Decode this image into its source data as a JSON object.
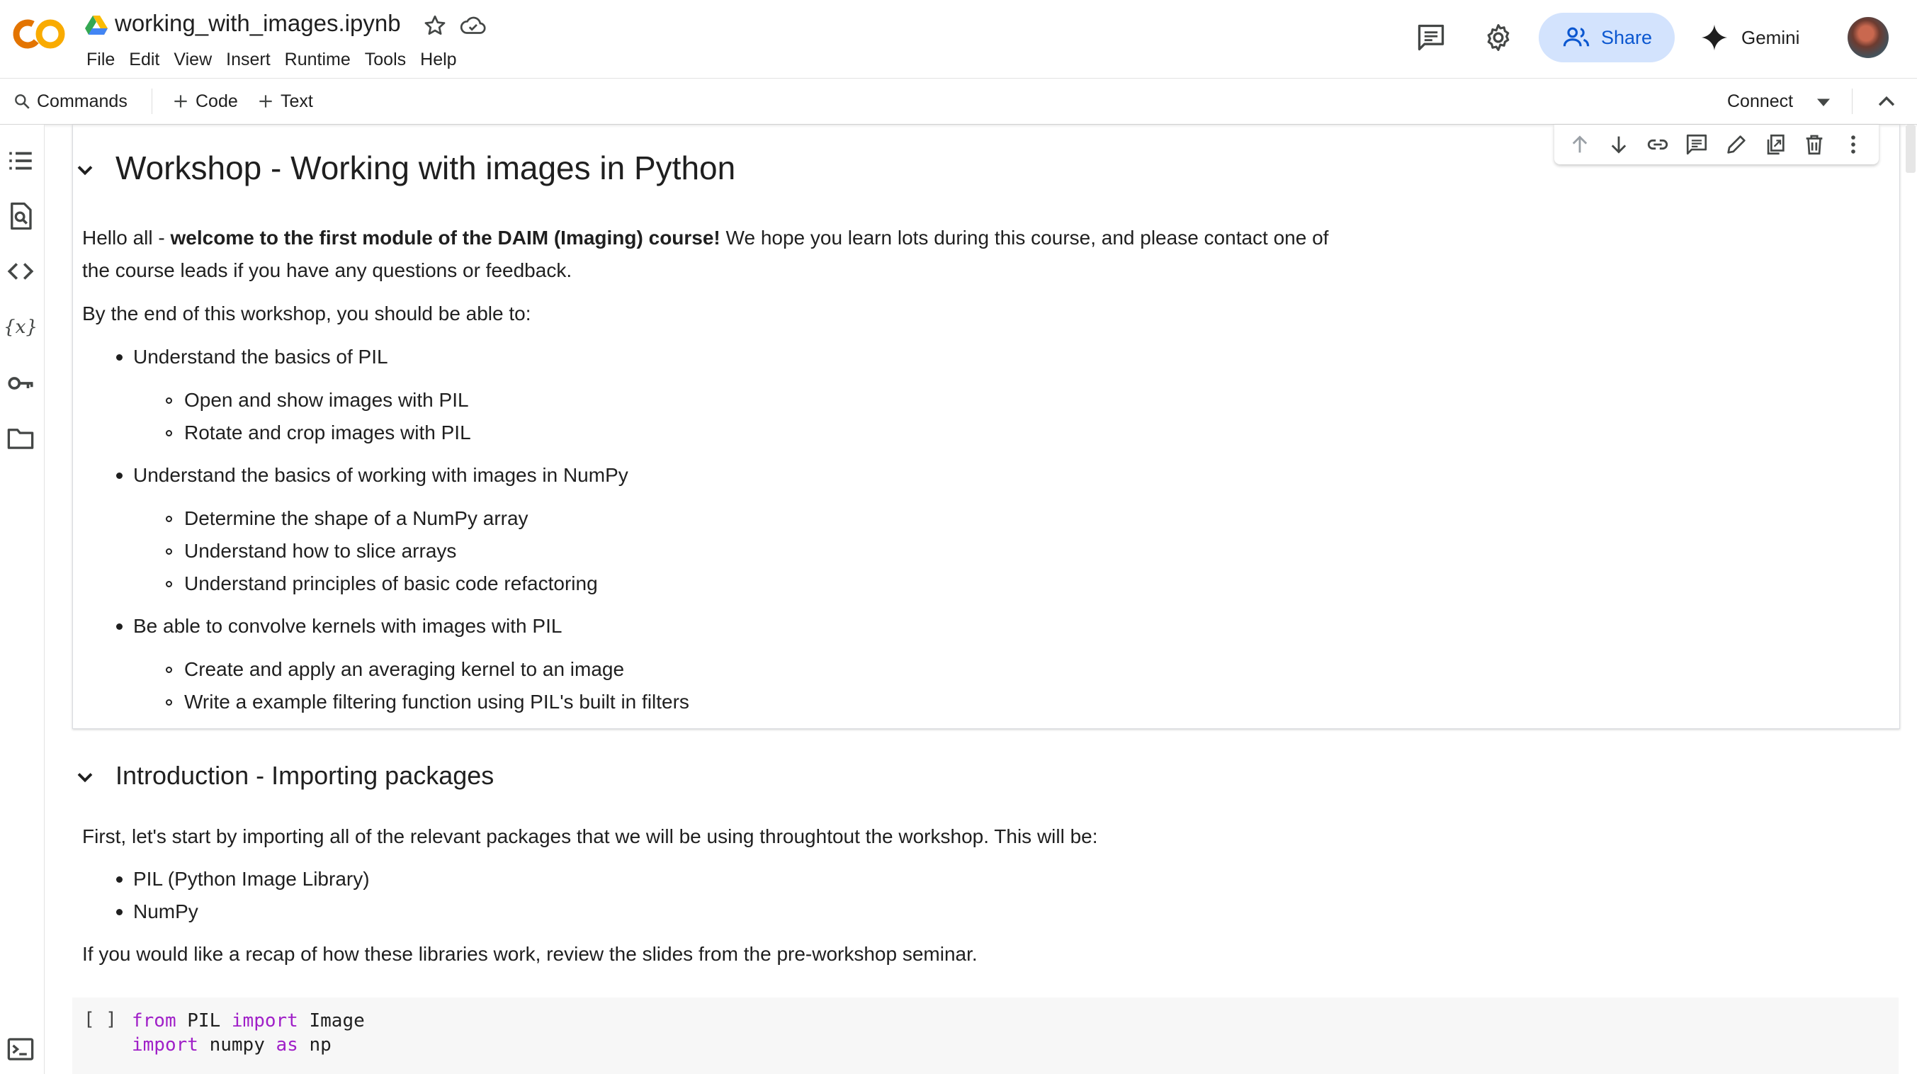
{
  "app": {
    "logo_text": "CO",
    "doc_title": "working_with_images.ipynb",
    "menu": [
      "File",
      "Edit",
      "View",
      "Insert",
      "Runtime",
      "Tools",
      "Help"
    ],
    "share_label": "Share",
    "gemini_label": "Gemini"
  },
  "toolbar": {
    "commands_label": "Commands",
    "code_label": "Code",
    "text_label": "Text",
    "connect_label": "Connect"
  },
  "rail_icons": [
    "table-of-contents-icon",
    "find-replace-icon",
    "code-snippets-icon",
    "variables-icon",
    "secrets-key-icon",
    "files-folder-icon",
    "terminal-icon"
  ],
  "cell_toolbar_icons": [
    "move-up-icon",
    "move-down-icon",
    "link-icon",
    "comment-icon",
    "edit-icon",
    "mirror-cell-icon",
    "delete-icon",
    "more-vert-icon"
  ],
  "cell1": {
    "heading": "Workshop - Working with images in Python",
    "intro_prefix": "Hello all - ",
    "intro_bold": "welcome to the first module of the DAIM (Imaging) course!",
    "intro_rest": " We hope you learn lots during this course, and please contact one of",
    "intro_line2": "the course leads if you have any questions or feedback.",
    "objectives_intro": "By the end of this workshop, you should be able to:",
    "objectives": [
      {
        "text": "Understand the basics of PIL",
        "sub": [
          "Open and show images with PIL",
          "Rotate and crop images with PIL"
        ]
      },
      {
        "text": "Understand the basics of working with images in NumPy",
        "sub": [
          "Determine the shape of a NumPy array",
          "Understand how to slice arrays",
          "Understand principles of basic code refactoring"
        ]
      },
      {
        "text": "Be able to convolve kernels with images with PIL",
        "sub": [
          "Create and apply an averaging kernel to an image",
          "Write a example filtering function using PIL's built in filters"
        ]
      }
    ]
  },
  "cell2": {
    "heading": "Introduction - Importing packages",
    "intro": "First, let's start by importing all of the relevant packages that we will be using throughtout the workshop. This will be:",
    "packages": [
      "PIL (Python Image Library)",
      "NumPy"
    ],
    "recap": "If you would like a recap of how these libraries work, review the slides from the pre-workshop seminar."
  },
  "code_cell": {
    "run_indicator": "[ ]",
    "line1": {
      "kw1": "from",
      "mod": " PIL ",
      "kw2": "import",
      "name": " Image"
    },
    "line2": {
      "kw1": "import",
      "mod": " numpy ",
      "kw2": "as",
      "name": " np"
    }
  },
  "colors": {
    "accent": "#0b57d0",
    "share_bg": "#d3e3fd",
    "keyword": "#a020c8",
    "logo_orange": "#f9ab00",
    "logo_dark_orange": "#e37400"
  }
}
